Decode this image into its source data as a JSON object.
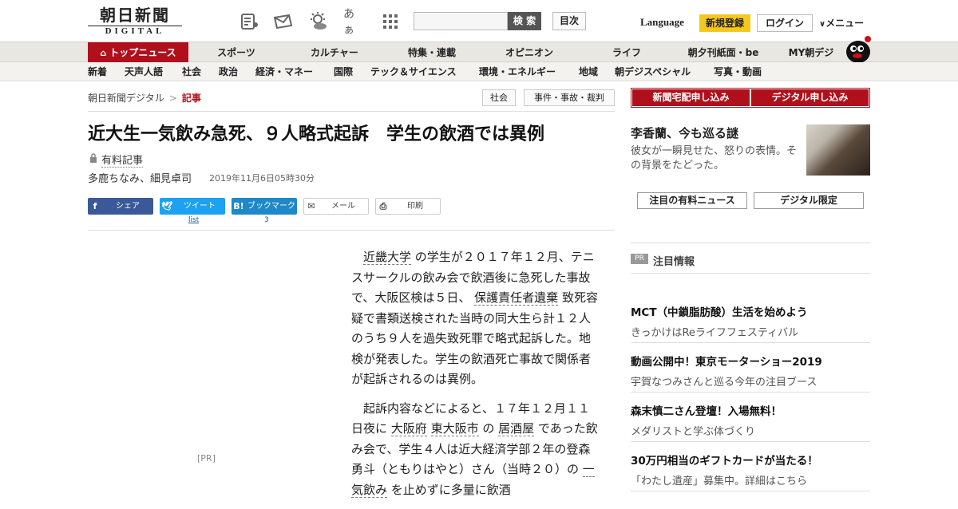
{
  "header": {
    "logo_jp": "朝日新聞",
    "logo_en": "DIGITAL",
    "icons": [
      "newspaper-icon",
      "envelope-icon",
      "weather-icon",
      "font-size-icon",
      "grid-menu-icon"
    ],
    "font_size_label": "あぁ",
    "search_placeholder": "",
    "search_button": "検 索",
    "toc_button": "目次",
    "language": "Language",
    "register": "新規登録",
    "login": "ログイン",
    "menu": "メニュー"
  },
  "nav_primary": [
    "トップニュース",
    "スポーツ",
    "カルチャー",
    "特集・連載",
    "オピニオン",
    "ライフ",
    "朝夕刊紙面・be",
    "MY朝デジ"
  ],
  "nav_secondary": [
    "新着",
    "天声人語",
    "社会",
    "政治",
    "経済・マネー",
    "国際",
    "テック＆サイエンス",
    "環境・エネルギー",
    "地域",
    "朝デジスペシャル",
    "写真・動画"
  ],
  "breadcrumb": {
    "home": "朝日新聞デジタル",
    "sep": ">",
    "current": "記事"
  },
  "tags": [
    "社会",
    "事件・事故・裁判"
  ],
  "article": {
    "title": "近大生一気飲み急死、９人略式起訴　学生の飲酒では異例",
    "paid_label": "有料記事",
    "authors": "多鹿ちなみ、細見卓司",
    "date": "2019年11月6日05時30分",
    "share": {
      "facebook": "シェア",
      "twitter": "ツイート",
      "hatena": "ブックマーク",
      "mail": "メール",
      "print": "印刷"
    },
    "share_counts": {
      "twitter": "list",
      "hatena": "3"
    },
    "pr_label": "[PR]",
    "p1": {
      "link1": "近畿大学",
      "t1": " の学生が２０１７年１２月、テニスサークルの飲み会で飲酒後に急死した事故で、大阪区検は５日、 ",
      "link2": "保護責任者遺棄",
      "t2": " 致死容疑で書類送検された当時の同大生ら計１２人のうち９人を過失致死罪で略式起訴した。地検が発表した。学生の飲酒死亡事故で関係者が起訴されるのは異例。"
    },
    "p2": {
      "t1": "起訴内容などによると、１７年１２月１１日夜に ",
      "link1": "大阪府",
      "link2": "東大阪市",
      "t2": " の ",
      "link3": "居酒屋",
      "t3": " であった飲み会で、学生４人は近大経済学部２年の登森勇斗（ともりはやと）さん（当時２０）の ",
      "link4": "一気飲み",
      "t4": " を止めずに多量に飲酒"
    }
  },
  "sidebar": {
    "btn_delivery": "新聞宅配申し込み",
    "btn_digital": "デジタル申し込み",
    "feature_title": "李香蘭、今も巡る謎",
    "feature_desc": "彼女が一瞬見せた、怒りの表情。その背景をたどった。",
    "box1": "注目の有料ニュース",
    "box2": "デジタル限定",
    "pr_badge": "PR",
    "attention": "注目情報",
    "pr_items": [
      {
        "title": "MCT（中鎖脂肪酸）生活を始めよう",
        "sub": "きっかけはReライフフェスティバル"
      },
      {
        "title": "動画公開中！東京モーターショー2019",
        "sub": "宇賀なつみさんと巡る今年の注目ブース"
      },
      {
        "title": "森末慎二さん登壇！入場無料！",
        "sub": "メダリストと学ぶ体づくり"
      },
      {
        "title": "30万円相当のギフトカードが当たる！",
        "sub": "「わたし遺産」募集中。詳細はこちら"
      }
    ]
  },
  "colors": {
    "brand_red": "#b0101c",
    "register_yellow": "#f5c81e",
    "facebook": "#3b5998",
    "twitter": "#1da1f2",
    "hatena": "#1e88c8"
  }
}
